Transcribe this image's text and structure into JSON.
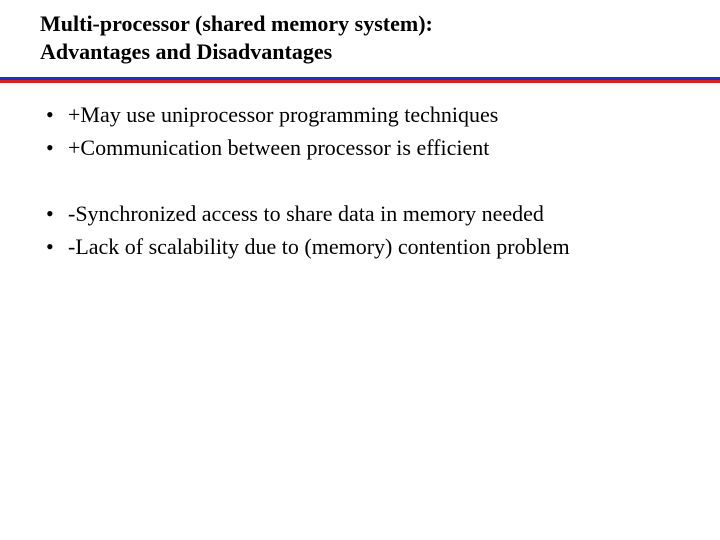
{
  "title": {
    "line1": "Multi-processor (shared memory system):",
    "line2": "Advantages and Disadvantages"
  },
  "advantages": [
    "+May use uniprocessor programming techniques",
    "+Communication between processor is efficient"
  ],
  "disadvantages": [
    "-Synchronized access to share data in memory needed",
    "-Lack of scalability due to (memory) contention problem"
  ]
}
